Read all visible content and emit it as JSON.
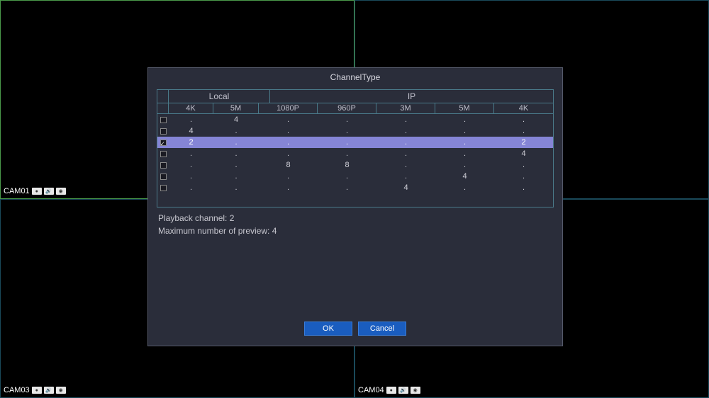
{
  "cams": {
    "c1": "CAM01",
    "c3": "CAM03",
    "c4": "CAM04"
  },
  "dialog": {
    "title": "ChannelType",
    "groups": {
      "local": "Local",
      "ip": "IP"
    },
    "columns": {
      "c1": "4K",
      "c2": "5M",
      "c3": "1080P",
      "c4": "960P",
      "c5": "3M",
      "c6": "5M",
      "c7": "4K"
    },
    "rows": [
      {
        "checked": false,
        "selected": false,
        "c1": ".",
        "c2": "4",
        "c3": ".",
        "c4": ".",
        "c5": ".",
        "c6": ".",
        "c7": "."
      },
      {
        "checked": false,
        "selected": false,
        "c1": "4",
        "c2": ".",
        "c3": ".",
        "c4": ".",
        "c5": ".",
        "c6": ".",
        "c7": "."
      },
      {
        "checked": true,
        "selected": true,
        "c1": "2",
        "c2": ".",
        "c3": ".",
        "c4": ".",
        "c5": ".",
        "c6": ".",
        "c7": "2"
      },
      {
        "checked": false,
        "selected": false,
        "c1": ".",
        "c2": ".",
        "c3": ".",
        "c4": ".",
        "c5": ".",
        "c6": ".",
        "c7": "4"
      },
      {
        "checked": false,
        "selected": false,
        "c1": ".",
        "c2": ".",
        "c3": "8",
        "c4": "8",
        "c5": ".",
        "c6": ".",
        "c7": "."
      },
      {
        "checked": false,
        "selected": false,
        "c1": ".",
        "c2": ".",
        "c3": ".",
        "c4": ".",
        "c5": ".",
        "c6": "4",
        "c7": "."
      },
      {
        "checked": false,
        "selected": false,
        "c1": ".",
        "c2": ".",
        "c3": ".",
        "c4": ".",
        "c5": "4",
        "c6": ".",
        "c7": "."
      }
    ],
    "info1": "Playback channel: 2",
    "info2": "Maximum number of preview: 4",
    "ok": "OK",
    "cancel": "Cancel"
  }
}
